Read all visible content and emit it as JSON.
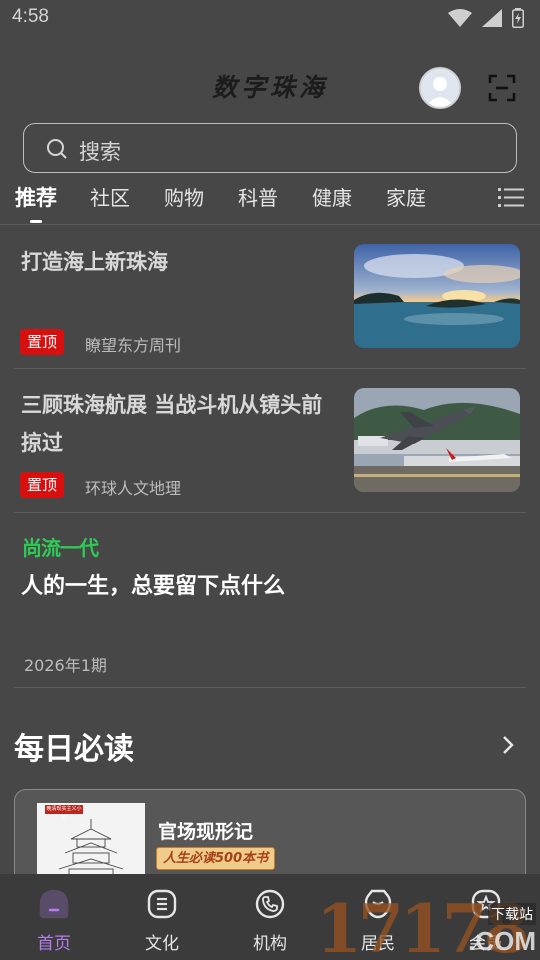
{
  "status_bar": {
    "time": "4:58"
  },
  "header": {
    "app_title": "数字珠海"
  },
  "search": {
    "placeholder": "搜索"
  },
  "tabs": [
    {
      "label": "推荐",
      "active": true
    },
    {
      "label": "社区"
    },
    {
      "label": "购物"
    },
    {
      "label": "科普"
    },
    {
      "label": "健康"
    },
    {
      "label": "家庭"
    }
  ],
  "news": [
    {
      "title": "打造海上新珠海",
      "badge": "置顶",
      "source": "瞭望东方周刊"
    },
    {
      "title": "三顾珠海航展 当战斗机从镜头前掠过",
      "badge": "置顶",
      "source": "环球人文地理"
    }
  ],
  "feature": {
    "brand": "尚流一代",
    "title": "人的一生，总要留下点什么",
    "issue": "2026年1期"
  },
  "daily_read": {
    "section_title": "每日必读",
    "book": {
      "cover_label": "晚清现实主义小说",
      "title": "官场现形记",
      "tag": "人生必读500本书"
    }
  },
  "bottom_nav": [
    {
      "label": "首页",
      "icon": "home-icon",
      "active": true
    },
    {
      "label": "文化",
      "icon": "culture-icon"
    },
    {
      "label": "机构",
      "icon": "phone-icon"
    },
    {
      "label": "居民",
      "icon": "resident-icon"
    },
    {
      "label": "会员",
      "icon": "member-icon"
    }
  ],
  "watermark": {
    "number": "17178",
    "tag": "下载站",
    "domain": ".COM"
  },
  "colors": {
    "background": "#474747",
    "badge": "#d80f0f",
    "accent": "#b57ef0",
    "brand_green": "#2ecc55"
  }
}
